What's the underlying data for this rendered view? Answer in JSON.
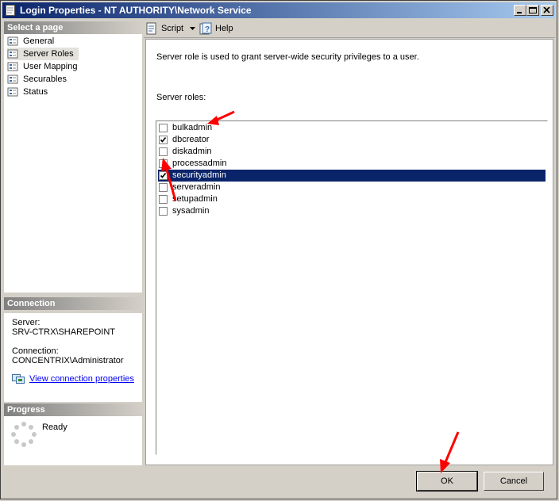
{
  "window": {
    "title": "Login Properties - NT AUTHORITY\\Network Service"
  },
  "left": {
    "select_page_header": "Select a page",
    "pages": [
      {
        "label": "General",
        "selected": false
      },
      {
        "label": "Server Roles",
        "selected": true
      },
      {
        "label": "User Mapping",
        "selected": false
      },
      {
        "label": "Securables",
        "selected": false
      },
      {
        "label": "Status",
        "selected": false
      }
    ],
    "connection_header": "Connection",
    "server_label": "Server:",
    "server_value": "SRV-CTRX\\SHAREPOINT",
    "connection_label": "Connection:",
    "connection_value": "CONCENTRIX\\Administrator",
    "view_connection_link": "View connection properties",
    "progress_header": "Progress",
    "progress_status": "Ready"
  },
  "toolbar": {
    "script_label": "Script",
    "help_label": "Help"
  },
  "main": {
    "description": "Server role is used to grant server-wide security privileges to a user.",
    "roles_label": "Server roles:",
    "roles": [
      {
        "name": "bulkadmin",
        "checked": false,
        "selected": false
      },
      {
        "name": "dbcreator",
        "checked": true,
        "selected": false
      },
      {
        "name": "diskadmin",
        "checked": false,
        "selected": false
      },
      {
        "name": "processadmin",
        "checked": false,
        "selected": false
      },
      {
        "name": "securityadmin",
        "checked": true,
        "selected": true
      },
      {
        "name": "serveradmin",
        "checked": false,
        "selected": false
      },
      {
        "name": "setupadmin",
        "checked": false,
        "selected": false
      },
      {
        "name": "sysadmin",
        "checked": false,
        "selected": false
      }
    ]
  },
  "buttons": {
    "ok_label": "OK",
    "cancel_label": "Cancel"
  },
  "colors": {
    "selection": "#0a246a",
    "annotation_arrow": "#ff0000"
  }
}
